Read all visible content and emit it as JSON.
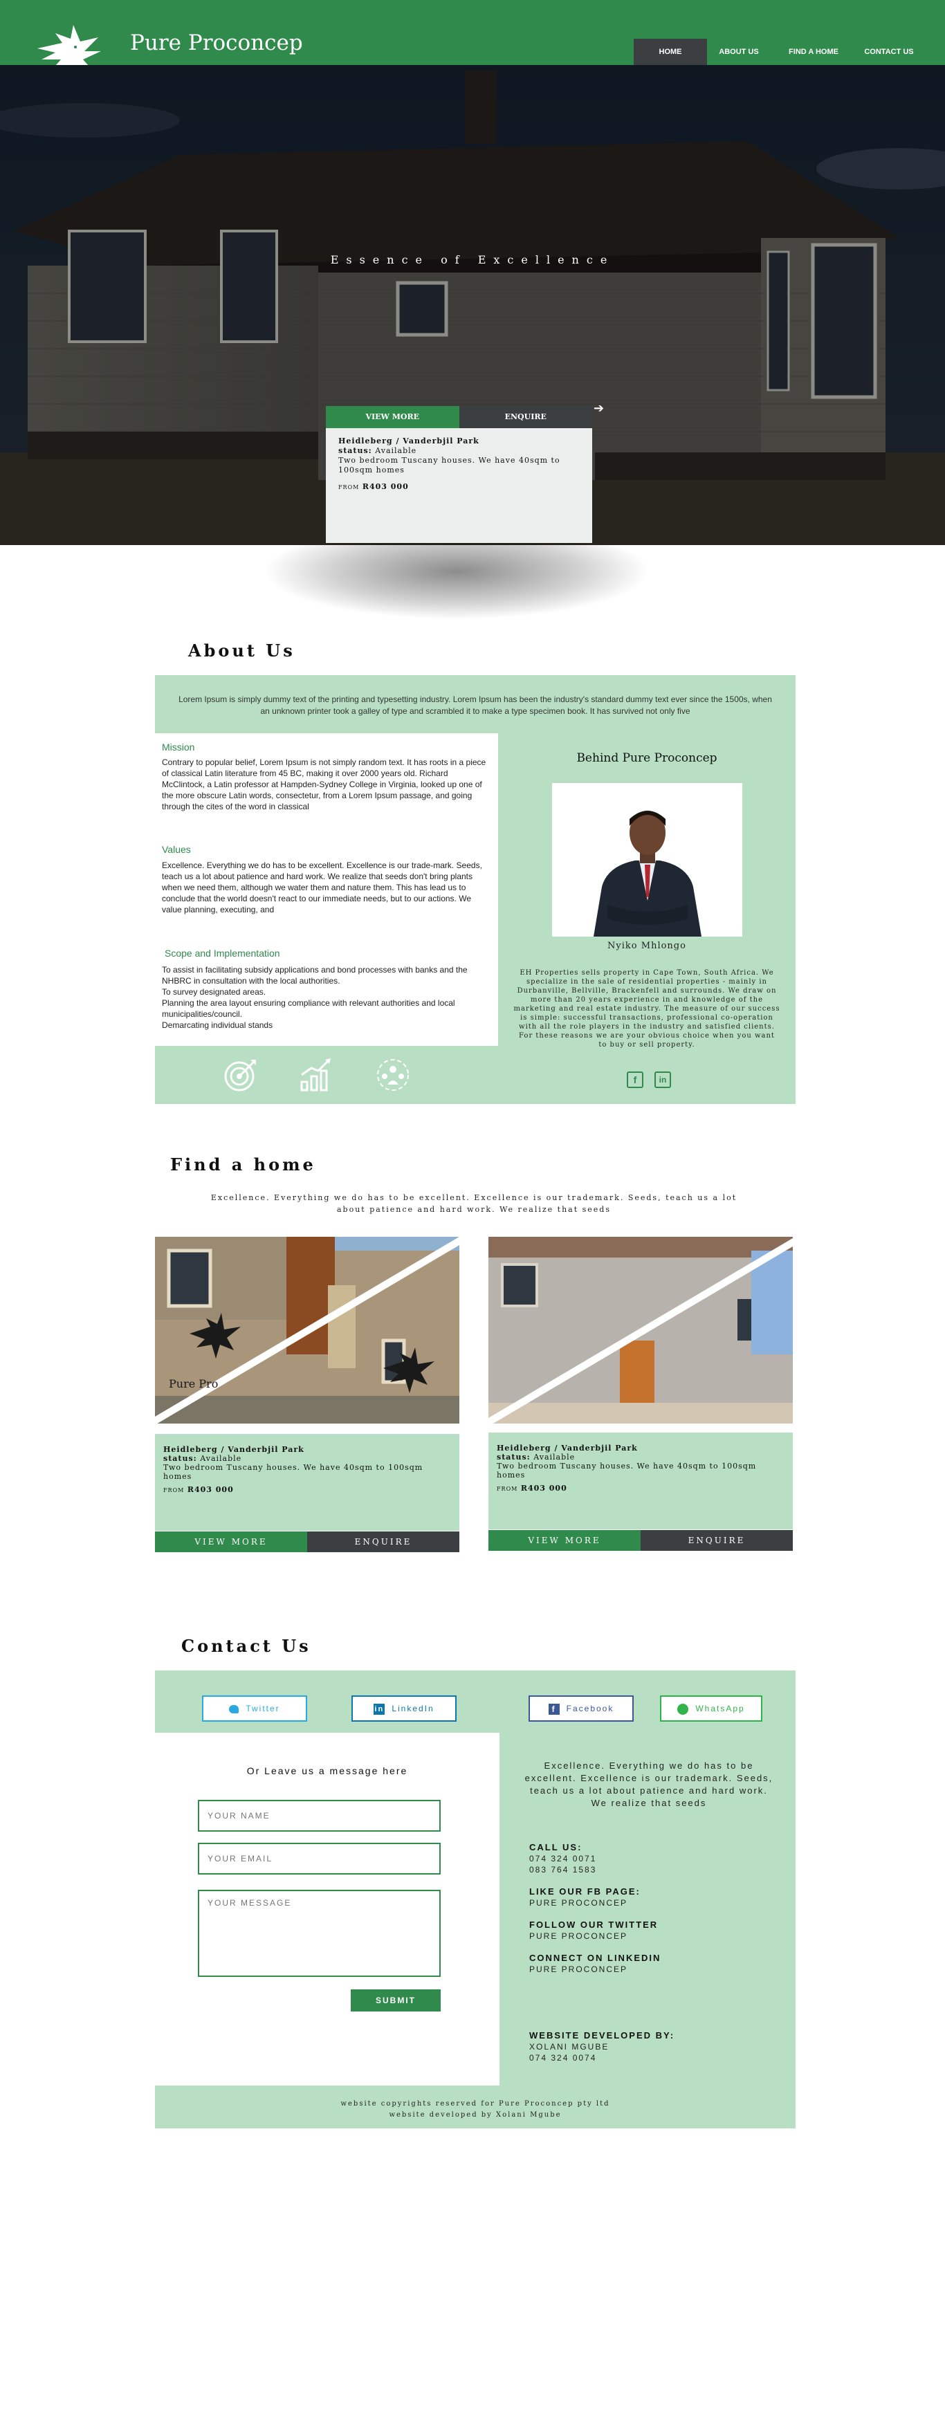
{
  "header": {
    "brand": "Pure Proconcep",
    "nav": [
      "HOME",
      "ABOUT US",
      "FIND A HOME",
      "CONTACT US"
    ]
  },
  "hero": {
    "tagline": "Essence of Excellence",
    "card": {
      "tab_view": "VIEW MORE",
      "tab_enquire": "ENQUIRE",
      "location": "Heidleberg / Vanderbjil Park",
      "status_label": "status:",
      "status_value": "Available",
      "description": "Two bedroom Tuscany houses. We have 40sqm to 100sqm homes",
      "from_label": "FROM",
      "price": "R403 000"
    },
    "arrow_icon": "arrow-right-icon"
  },
  "about": {
    "title": "About Us",
    "intro": "Lorem Ipsum is simply dummy text of the printing and typesetting industry. Lorem Ipsum has been the industry's standard dummy text ever since the 1500s, when an unknown printer took a galley of type and scrambled it to make a type specimen book. It has survived not only five",
    "mission_title": "Mission",
    "mission_text": "Contrary to popular belief, Lorem Ipsum is not simply random text. It has roots in a piece of classical Latin literature from 45 BC, making it over 2000 years old. Richard McClintock, a Latin professor at Hampden-Sydney College in Virginia, looked up one of the more obscure Latin words, consectetur, from a Lorem Ipsum passage, and going through the cites of the word in classical",
    "values_title": "Values",
    "values_text": "Excellence. Everything we do has to be excellent. Excellence is our trade-mark. Seeds, teach us a lot about patience and hard work. We realize that seeds don't bring plants when we need them, although we water them and nature them. This has lead us to conclude that the world doesn't react to our immediate needs, but to our actions. We value planning, executing, and",
    "scope_title": "Scope and Implementation",
    "scope_lines": [
      "To assist in facilitating subsidy applications and bond processes with banks and the NHBRC in consultation with the local authorities.",
      "To survey designated areas.",
      "Planning the area layout ensuring compliance with relevant authorities and local municipalities/council.",
      "Demarcating individual stands"
    ],
    "behind_title": "Behind Pure Proconcep",
    "person_name": "Nyiko Mhlongo",
    "behind_text": "EH Properties sells property in Cape Town, South Africa. We specialize in the sale of residential properties - mainly in Durbanville, Bellville, Brackenfell and surrounds. We draw on more than 20 years experience in and knowledge of the marketing and real estate industry. The measure of our success is simple: successful transactions, professional co-operation with all the role players in the industry and satisfied clients. For these reasons we are your obvious choice when you want to buy or sell property.",
    "social_icons": [
      "facebook-icon",
      "linkedin-icon"
    ],
    "feature_icons": [
      "target-icon",
      "growth-chart-icon",
      "team-icon"
    ]
  },
  "find": {
    "title": "Find a home",
    "intro": "Excellence. Everything we do has to be excellent. Excellence is our trademark. Seeds, teach us a lot about patience and hard work. We realize that seeds",
    "watermark": "Pure Pro",
    "homes": [
      {
        "location": "Heidleberg / Vanderbjil Park",
        "status_label": "status:",
        "status_value": "Available",
        "description": "Two bedroom Tuscany houses. We have 40sqm to 100sqm homes",
        "from_label": "FROM",
        "price": "R403 000",
        "view_label": "VIEW MORE",
        "enquire_label": "ENQUIRE"
      },
      {
        "location": "Heidleberg / Vanderbjil Park",
        "status_label": "status:",
        "status_value": "Available",
        "description": "Two bedroom Tuscany houses. We have 40sqm to 100sqm homes",
        "from_label": "FROM",
        "price": "R403 000",
        "view_label": "VIEW MORE",
        "enquire_label": "ENQUIRE"
      }
    ]
  },
  "contact": {
    "title": "Contact Us",
    "social_buttons": [
      {
        "label": "Twitter",
        "icon": "twitter-icon",
        "color": "#2aa9e0"
      },
      {
        "label": "LinkedIn",
        "icon": "linkedin-icon",
        "color": "#0e76a8"
      },
      {
        "label": "Facebook",
        "icon": "facebook-icon",
        "color": "#3b5998"
      },
      {
        "label": "WhatsApp",
        "icon": "whatsapp-icon",
        "color": "#2fb44a"
      }
    ],
    "form_title": "Or Leave us a message here",
    "name_placeholder": "YOUR NAME",
    "email_placeholder": "YOUR EMAIL",
    "message_placeholder": "YOUR MESSAGE",
    "submit_label": "SUBMIT",
    "right_text": "Excellence. Everything we do has to be excellent. Excellence is our trademark. Seeds, teach us a lot about patience and hard work. We realize that seeds",
    "call_title": "CALL US:",
    "phone1": "074 324 0071",
    "phone2": "083 764 1583",
    "fb_title": "LIKE OUR FB PAGE:",
    "fb_value": "PURE PROCONCEP",
    "tw_title": "FOLLOW OUR TWITTER",
    "tw_value": "PURE PROCONCEP",
    "li_title": "CONNECT ON LINKEDIN",
    "li_value": "PURE PROCONCEP",
    "dev_title": "WEBSITE DEVELOPED BY:",
    "dev_name": "XOLANI MGUBE",
    "dev_phone": "074 324 0074"
  },
  "footer": {
    "copyright": "website copyrights reserved for Pure Proconcep pty ltd",
    "developer": "website developed by Xolani Mgube"
  },
  "colors": {
    "brand_green": "#2f8a4c",
    "light_green": "#b8dfc3",
    "dark_gray": "#3c3f42"
  }
}
